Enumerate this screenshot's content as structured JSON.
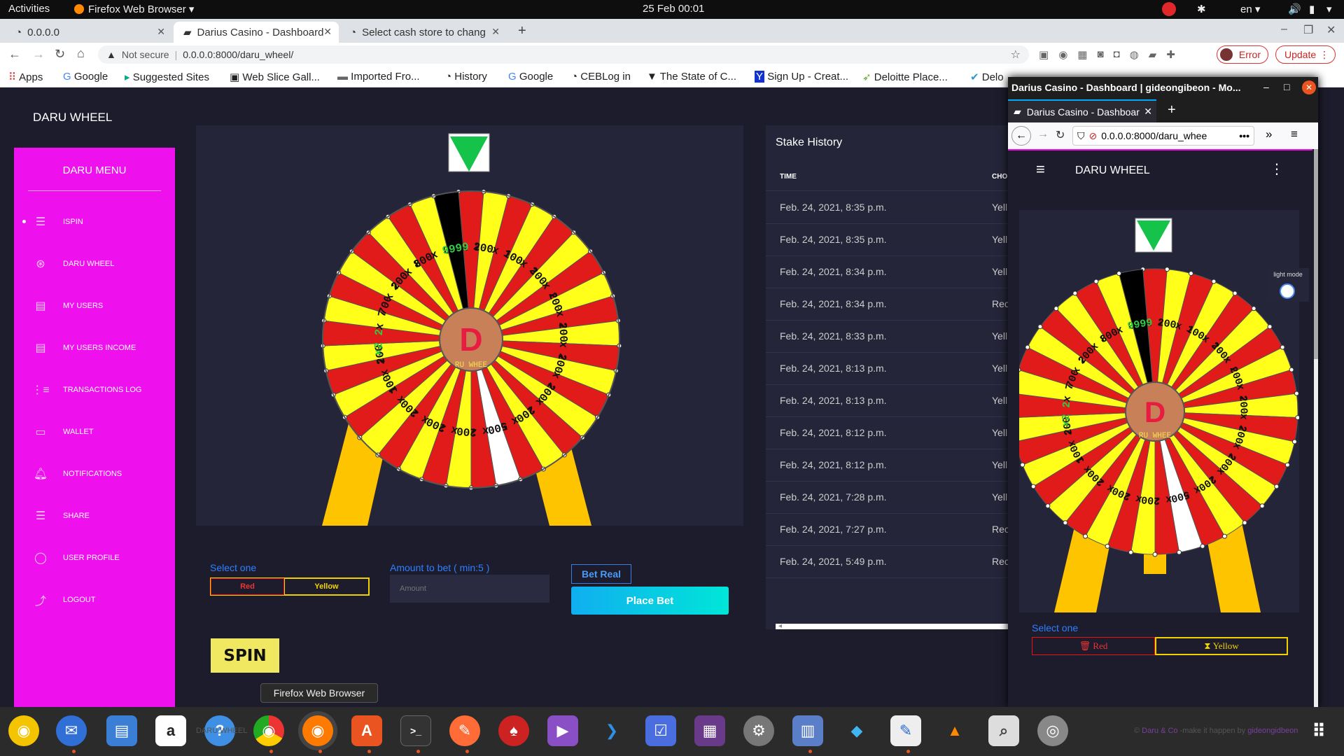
{
  "topbar": {
    "activities": "Activities",
    "app": "Firefox Web Browser ▾",
    "clock": "25 Feb  00:01",
    "lang": "en ▾"
  },
  "tabs": [
    {
      "title": "0.0.0.0"
    },
    {
      "title": "Darius Casino - Dashboard"
    },
    {
      "title": "Select cash store to chang"
    }
  ],
  "omnibar": {
    "security": "Not secure",
    "url": "0.0.0.0:8000/daru_wheel/",
    "error": "Error",
    "update": "Update"
  },
  "bookmarks": [
    "Apps",
    "Google",
    "Suggested Sites",
    "Web Slice Gall...",
    "Imported Fro...",
    "History",
    "Google",
    "CEBLog in",
    "The State of C...",
    "Sign Up - Creat...",
    "Deloitte Place...",
    "Delo"
  ],
  "page": {
    "title": "DARU WHEEL"
  },
  "sidebar": {
    "title": "DARU MENU",
    "items": [
      "ISPIN",
      "DARU WHEEL",
      "MY USERS",
      "MY USERS INCOME",
      "TRANSACTIONS LOG",
      "WALLET",
      "NOTIFICATIONS",
      "SHARE",
      "USER PROFILE",
      "LOGOUT"
    ]
  },
  "wheel": {
    "center_text": "RU WHEE",
    "segments": [
      "x 2",
      "2000",
      "x 3",
      "1000",
      "x 1",
      "2000",
      "x 0",
      "2000",
      "x 2",
      "2000",
      "x 2",
      "2000",
      "x 2",
      "2000",
      "x 2",
      "2000",
      "x 5",
      "5000",
      "x 2",
      "2000",
      "x 2",
      "2000",
      "x 2",
      "2000",
      "x 1",
      "1000",
      "x 2",
      "2000",
      "x2 200",
      "x 7",
      "700",
      "x 2",
      "2000",
      "x 8",
      "8000",
      "x 0",
      "9999"
    ]
  },
  "bet": {
    "select_label": "Select one",
    "red": "Red",
    "yellow": "Yellow",
    "amount_label": "Amount to bet ( min:5 )",
    "amount_placeholder": "Amount",
    "bet_real": "Bet Real",
    "place_bet": "Place Bet",
    "spin": "SPIN"
  },
  "stake": {
    "title": "Stake History",
    "col_time": "TIME",
    "col_choice": "CHO",
    "rows": [
      {
        "time": "Feb. 24, 2021, 8:35 p.m.",
        "choice": "Yell"
      },
      {
        "time": "Feb. 24, 2021, 8:35 p.m.",
        "choice": "Yell"
      },
      {
        "time": "Feb. 24, 2021, 8:34 p.m.",
        "choice": "Yell"
      },
      {
        "time": "Feb. 24, 2021, 8:34 p.m.",
        "choice": "Rec"
      },
      {
        "time": "Feb. 24, 2021, 8:33 p.m.",
        "choice": "Yell"
      },
      {
        "time": "Feb. 24, 2021, 8:13 p.m.",
        "choice": "Yell"
      },
      {
        "time": "Feb. 24, 2021, 8:13 p.m.",
        "choice": "Yell"
      },
      {
        "time": "Feb. 24, 2021, 8:12 p.m.",
        "choice": "Yell"
      },
      {
        "time": "Feb. 24, 2021, 8:12 p.m.",
        "choice": "Yell"
      },
      {
        "time": "Feb. 24, 2021, 7:28 p.m.",
        "choice": "Yell"
      },
      {
        "time": "Feb. 24, 2021, 7:27 p.m.",
        "choice": "Rec"
      },
      {
        "time": "Feb. 24, 2021, 5:49 p.m.",
        "choice": "Rec"
      }
    ]
  },
  "tooltip": "Firefox Web Browser",
  "footer": {
    "left": "DARU WHEEL",
    "right_prefix": "© ",
    "right_brand": "Daru & Co",
    "right_mid": " -make it happen by ",
    "right_author": "gideongidbeon"
  },
  "firefox": {
    "window_title": "Darius Casino - Dashboard | gideongibeon - Mo...",
    "tab": "Darius Casino - Dashboar",
    "url": "0.0.0.0:8000/daru_whee",
    "page_title": "DARU WHEEL",
    "light_mode": "light mode",
    "select_label": "Select one",
    "red": "Red",
    "yellow": "Yellow"
  },
  "colors": {
    "sidebar": "#ee11ee",
    "wheel_red": "#e11a1a",
    "wheel_yellow": "#ffff1a",
    "place_bet": "#0fd8e8",
    "spin_bg": "#f0e860"
  }
}
